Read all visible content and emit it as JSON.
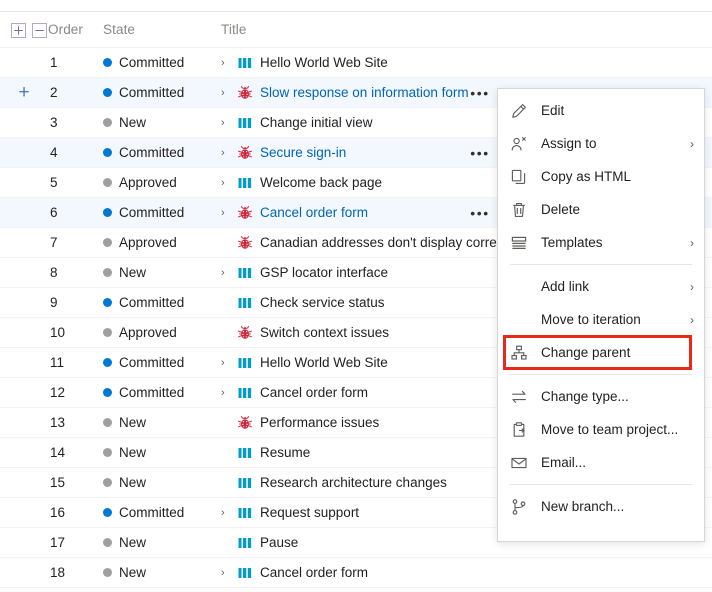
{
  "colors": {
    "link": "#0065b3",
    "state_active": "#0078d4",
    "state_inactive": "#a19f9d",
    "bug": "#cc293d",
    "story": "#009ccc",
    "highlight_box": "#e8281b",
    "row_selected_bg": "#f2f8fd"
  },
  "grid": {
    "toggles": {
      "expand_all": "+",
      "collapse_all": "−"
    },
    "columns": {
      "order": "Order",
      "state": "State",
      "title": "Title"
    },
    "ellipsis_label": "•••",
    "rows": [
      {
        "order": "1",
        "state": "Committed",
        "state_kind": "active",
        "chevron": true,
        "icon": "story-icon",
        "title": "Hello World Web Site",
        "link": false,
        "selected": false,
        "expander": false,
        "ellipsis": false
      },
      {
        "order": "2",
        "state": "Committed",
        "state_kind": "active",
        "chevron": true,
        "icon": "bug-icon",
        "title": "Slow response on information form",
        "link": true,
        "selected": true,
        "expander": true,
        "ellipsis": true
      },
      {
        "order": "3",
        "state": "New",
        "state_kind": "inactive",
        "chevron": true,
        "icon": "story-icon",
        "title": "Change initial view",
        "link": false,
        "selected": false,
        "expander": false,
        "ellipsis": false
      },
      {
        "order": "4",
        "state": "Committed",
        "state_kind": "active",
        "chevron": true,
        "icon": "bug-icon",
        "title": "Secure sign-in",
        "link": true,
        "selected": true,
        "expander": false,
        "ellipsis": true
      },
      {
        "order": "5",
        "state": "Approved",
        "state_kind": "inactive",
        "chevron": true,
        "icon": "story-icon",
        "title": "Welcome back page",
        "link": false,
        "selected": false,
        "expander": false,
        "ellipsis": false
      },
      {
        "order": "6",
        "state": "Committed",
        "state_kind": "active",
        "chevron": true,
        "icon": "bug-icon",
        "title": "Cancel order form",
        "link": true,
        "selected": true,
        "expander": false,
        "ellipsis": true
      },
      {
        "order": "7",
        "state": "Approved",
        "state_kind": "inactive",
        "chevron": false,
        "icon": "bug-icon",
        "title": "Canadian addresses don't display correctly",
        "link": false,
        "selected": false,
        "expander": false,
        "ellipsis": false
      },
      {
        "order": "8",
        "state": "New",
        "state_kind": "inactive",
        "chevron": true,
        "icon": "story-icon",
        "title": "GSP locator interface",
        "link": false,
        "selected": false,
        "expander": false,
        "ellipsis": false
      },
      {
        "order": "9",
        "state": "Committed",
        "state_kind": "active",
        "chevron": false,
        "icon": "story-icon",
        "title": "Check service status",
        "link": false,
        "selected": false,
        "expander": false,
        "ellipsis": false
      },
      {
        "order": "10",
        "state": "Approved",
        "state_kind": "inactive",
        "chevron": false,
        "icon": "bug-icon",
        "title": "Switch context issues",
        "link": false,
        "selected": false,
        "expander": false,
        "ellipsis": false
      },
      {
        "order": "11",
        "state": "Committed",
        "state_kind": "active",
        "chevron": true,
        "icon": "story-icon",
        "title": "Hello World Web Site",
        "link": false,
        "selected": false,
        "expander": false,
        "ellipsis": false
      },
      {
        "order": "12",
        "state": "Committed",
        "state_kind": "active",
        "chevron": true,
        "icon": "story-icon",
        "title": "Cancel order form",
        "link": false,
        "selected": false,
        "expander": false,
        "ellipsis": false
      },
      {
        "order": "13",
        "state": "New",
        "state_kind": "inactive",
        "chevron": false,
        "icon": "bug-icon",
        "title": "Performance issues",
        "link": false,
        "selected": false,
        "expander": false,
        "ellipsis": false
      },
      {
        "order": "14",
        "state": "New",
        "state_kind": "inactive",
        "chevron": false,
        "icon": "story-icon",
        "title": "Resume",
        "link": false,
        "selected": false,
        "expander": false,
        "ellipsis": false
      },
      {
        "order": "15",
        "state": "New",
        "state_kind": "inactive",
        "chevron": false,
        "icon": "story-icon",
        "title": "Research architecture changes",
        "link": false,
        "selected": false,
        "expander": false,
        "ellipsis": false
      },
      {
        "order": "16",
        "state": "Committed",
        "state_kind": "active",
        "chevron": true,
        "icon": "story-icon",
        "title": "Request support",
        "link": false,
        "selected": false,
        "expander": false,
        "ellipsis": false
      },
      {
        "order": "17",
        "state": "New",
        "state_kind": "inactive",
        "chevron": false,
        "icon": "story-icon",
        "title": "Pause",
        "link": false,
        "selected": false,
        "expander": false,
        "ellipsis": false
      },
      {
        "order": "18",
        "state": "New",
        "state_kind": "inactive",
        "chevron": true,
        "icon": "story-icon",
        "title": "Cancel order form",
        "link": false,
        "selected": false,
        "expander": false,
        "ellipsis": false
      }
    ]
  },
  "context_menu": {
    "submenu_glyph": "›",
    "items": [
      {
        "kind": "item",
        "label": "Edit",
        "icon": "pencil-icon",
        "submenu": false,
        "highlighted": false
      },
      {
        "kind": "item",
        "label": "Assign to",
        "icon": "assign-person-icon",
        "submenu": true,
        "highlighted": false
      },
      {
        "kind": "item",
        "label": "Copy as HTML",
        "icon": "copy-icon",
        "submenu": false,
        "highlighted": false
      },
      {
        "kind": "item",
        "label": "Delete",
        "icon": "trash-icon",
        "submenu": false,
        "highlighted": false
      },
      {
        "kind": "item",
        "label": "Templates",
        "icon": "templates-icon",
        "submenu": true,
        "highlighted": false
      },
      {
        "kind": "separator",
        "label": "",
        "icon": "",
        "submenu": false,
        "highlighted": false
      },
      {
        "kind": "item",
        "label": "Add link",
        "icon": "none-icon",
        "submenu": true,
        "highlighted": false
      },
      {
        "kind": "item",
        "label": "Move to iteration",
        "icon": "none-icon",
        "submenu": true,
        "highlighted": false
      },
      {
        "kind": "item",
        "label": "Change parent",
        "icon": "hierarchy-icon",
        "submenu": false,
        "highlighted": true
      },
      {
        "kind": "separator",
        "label": "",
        "icon": "",
        "submenu": false,
        "highlighted": false
      },
      {
        "kind": "item",
        "label": "Change type...",
        "icon": "swap-icon",
        "submenu": false,
        "highlighted": false
      },
      {
        "kind": "item",
        "label": "Move to team project...",
        "icon": "clipboard-move-icon",
        "submenu": false,
        "highlighted": false
      },
      {
        "kind": "item",
        "label": "Email...",
        "icon": "envelope-icon",
        "submenu": false,
        "highlighted": false
      },
      {
        "kind": "separator",
        "label": "",
        "icon": "",
        "submenu": false,
        "highlighted": false
      },
      {
        "kind": "item",
        "label": "New branch...",
        "icon": "branch-icon",
        "submenu": false,
        "highlighted": false
      }
    ]
  }
}
